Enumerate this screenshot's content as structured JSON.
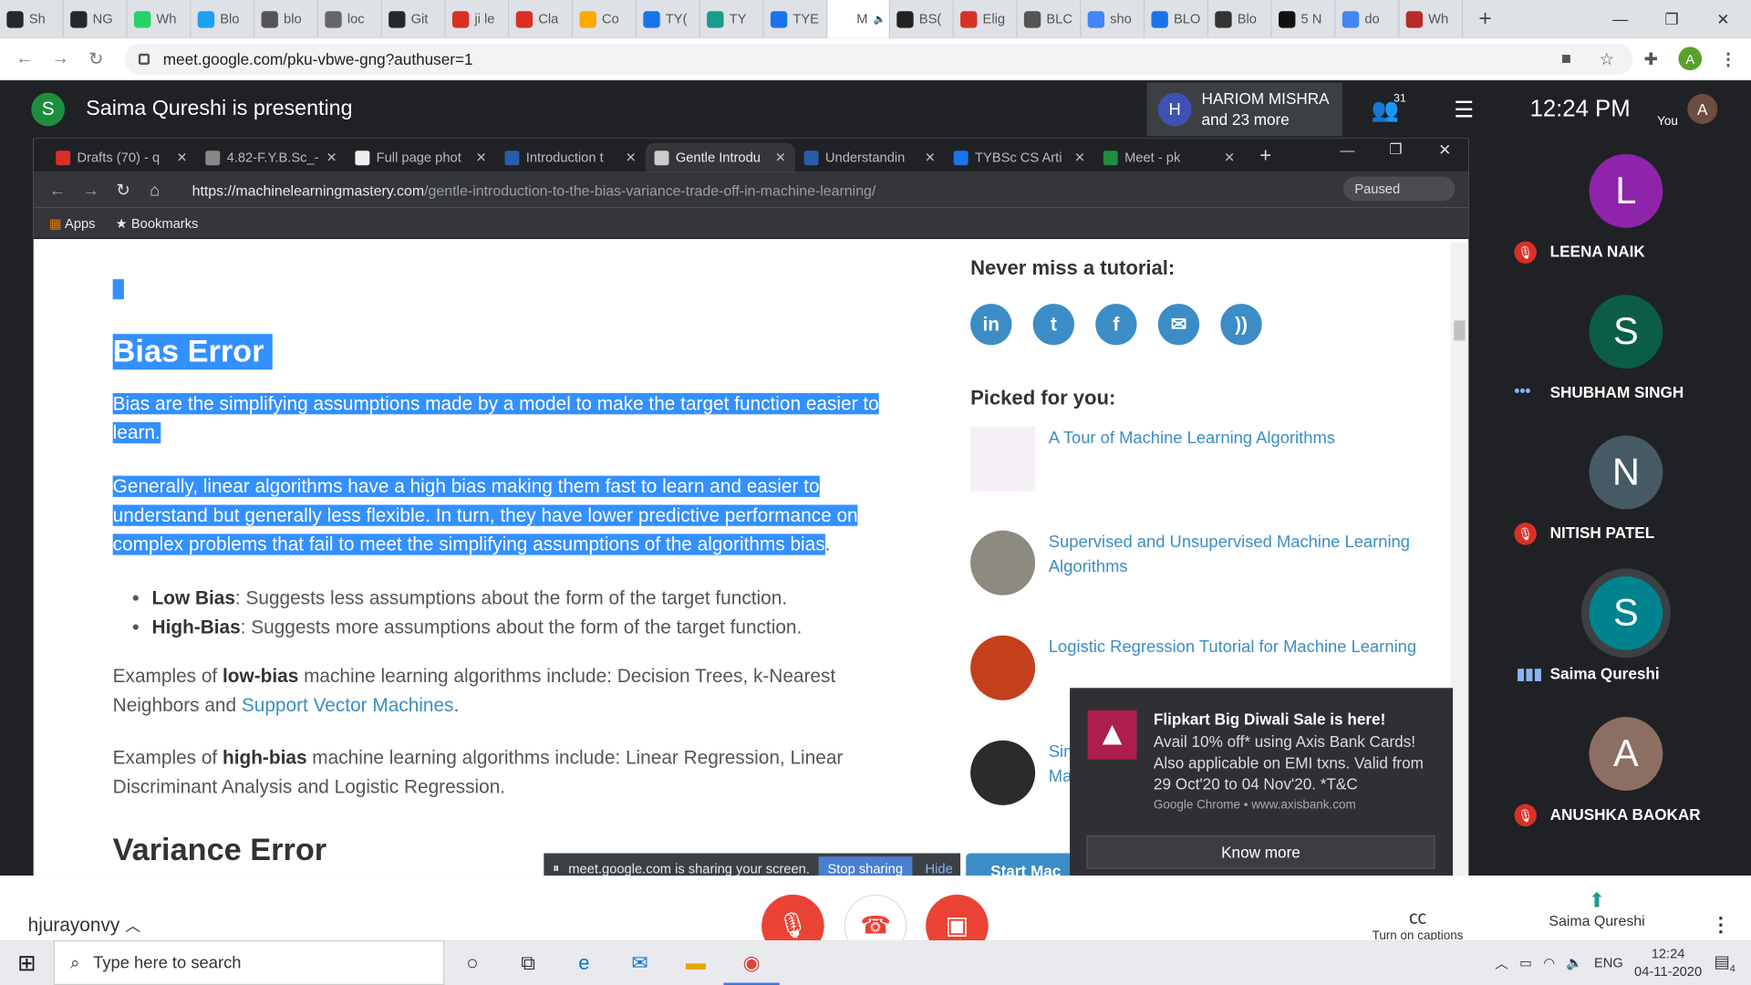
{
  "outer_tabs": [
    {
      "label": "Sh",
      "fav": "#24292e",
      "icon": "github-icon"
    },
    {
      "label": "NG",
      "fav": "#24292e",
      "icon": "github-icon"
    },
    {
      "label": "Wh",
      "fav": "#25d366",
      "icon": "whatsapp-icon"
    },
    {
      "label": "Blo",
      "fav": "#1da1f2",
      "icon": "blog-icon"
    },
    {
      "label": "blo",
      "fav": "#555",
      "icon": "globe-icon"
    },
    {
      "label": "loc",
      "fav": "#666",
      "icon": "doc-icon"
    },
    {
      "label": "Git",
      "fav": "#24292e",
      "icon": "github-icon"
    },
    {
      "label": "ji le",
      "fav": "#d93025",
      "icon": "gmail-icon"
    },
    {
      "label": "Cla",
      "fav": "#d93025",
      "icon": "gmail-icon"
    },
    {
      "label": "Co",
      "fav": "#f9ab00",
      "icon": "classroom-icon"
    },
    {
      "label": "TY(",
      "fav": "#1a73e8",
      "icon": "classroom-icon"
    },
    {
      "label": "TY",
      "fav": "#1a9c8f",
      "icon": "classroom-icon"
    },
    {
      "label": "TYE",
      "fav": "#1a73e8",
      "icon": "classroom-icon"
    },
    {
      "label": "M",
      "fav": "#fff",
      "icon": "audio-icon",
      "active": true
    },
    {
      "label": "BS(",
      "fav": "#222",
      "icon": "it-icon"
    },
    {
      "label": "Elig",
      "fav": "#d93025",
      "icon": "drop-icon"
    },
    {
      "label": "BLC",
      "fav": "#555",
      "icon": "s-icon"
    },
    {
      "label": "sho",
      "fav": "#4285f4",
      "icon": "google-icon"
    },
    {
      "label": "BLO",
      "fav": "#1a73e8",
      "icon": "table-icon"
    },
    {
      "label": "Blo",
      "fav": "#333",
      "icon": "wikipedia-icon"
    },
    {
      "label": "5 N",
      "fav": "#111",
      "icon": "v-icon"
    },
    {
      "label": "do",
      "fav": "#4285f4",
      "icon": "google-icon"
    },
    {
      "label": "Wh",
      "fav": "#b92b27",
      "icon": "quora-icon"
    }
  ],
  "outer_url": "meet.google.com/pku-vbwe-gng?authuser=1",
  "profile_initial": "A",
  "meet": {
    "presenter_initial": "S",
    "presenting_text": "Saima Qureshi is presenting",
    "host_initial": "H",
    "host_name": "HARIOM MISHRA",
    "host_more": "and 23 more",
    "people_count": "31",
    "time": "12:24 PM",
    "you_label": "You",
    "you_initial": "A",
    "meeting_code": "hjurayonvy",
    "captions_label": "Turn on captions",
    "presenter_label": "Saima Qureshi"
  },
  "inner_tabs": [
    {
      "label": "Drafts (70) - q",
      "fav": "#d93025"
    },
    {
      "label": "4.82-F.Y.B.Sc_-",
      "fav": "#888"
    },
    {
      "label": "Full page phot",
      "fav": "#eee"
    },
    {
      "label": "Introduction t",
      "fav": "#2a5caa"
    },
    {
      "label": "Gentle Introdu",
      "fav": "#ccc",
      "active": true
    },
    {
      "label": "Understandin",
      "fav": "#2a5caa"
    },
    {
      "label": "TYBSc CS Arti",
      "fav": "#1a73e8"
    },
    {
      "label": "Meet - pk",
      "fav": "#1e8e3e"
    }
  ],
  "inner_url_host": "https://machinelearningmastery.com",
  "inner_url_path": "/gentle-introduction-to-the-bias-variance-trade-off-in-machine-learning/",
  "paused_label": "Paused",
  "bookmarks": {
    "apps": "Apps",
    "bookmarks": "Bookmarks"
  },
  "article": {
    "heading": "Bias Error",
    "p1": "Bias are the simplifying assumptions made by a model to make the target function easier to learn.",
    "p2": "Generally, linear algorithms have a high bias making them fast to learn and easier to understand but generally less flexible. In turn, they have lower predictive performance on complex problems that fail to meet the simplifying assumptions of the algorithms bias",
    "p2_end": ".",
    "li1_b": "Low Bias",
    "li1": ": Suggests less assumptions about the form of the target function.",
    "li2_b": "High-Bias",
    "li2": ": Suggests more assumptions about the form of the target function.",
    "ex1_a": "Examples of ",
    "ex1_b": "low-bias",
    "ex1_c": " machine learning algorithms include: Decision Trees, k-Nearest Neighbors and ",
    "ex1_link": "Support Vector Machines",
    "ex1_d": ".",
    "ex2_a": "Examples of ",
    "ex2_b": "high-bias",
    "ex2_c": " machine learning algorithms include: Linear Regression, Linear Discriminant Analysis and Logistic Regression.",
    "heading2": "Variance Error"
  },
  "sidebar": {
    "never_miss": "Never miss a tutorial:",
    "picked": "Picked for you:",
    "picks": [
      "A Tour of Machine Learning Algorithms",
      "Supervised and Unsupervised Machine Learning Algorithms",
      "Logistic Regression Tutorial for Machine Learning",
      "Sim\nMa"
    ]
  },
  "share_bar": {
    "text": "meet.google.com is sharing your screen.",
    "stop": "Stop sharing",
    "hide": "Hide"
  },
  "start_btn": "Start Mac",
  "notification": {
    "title": "Flipkart Big Diwali Sale is here!",
    "body": "Avail 10% off* using Axis Bank Cards! Also applicable on EMI txns. Valid from 29 Oct'20 to 04 Nov'20. *T&C",
    "source": "Google Chrome • www.axisbank.com",
    "button": "Know more"
  },
  "participants": [
    {
      "initial": "L",
      "name": "LEENA NAIK",
      "color": "#8e24aa",
      "status": "muted"
    },
    {
      "initial": "S",
      "name": "SHUBHAM SINGH",
      "color": "#0b5e45",
      "status": "dots"
    },
    {
      "initial": "N",
      "name": "NITISH PATEL",
      "color": "#455a64",
      "status": "muted"
    },
    {
      "initial": "S",
      "name": "Saima Qureshi",
      "color": "#00838f",
      "status": "speaking"
    },
    {
      "initial": "A",
      "name": "ANUSHKA BAOKAR",
      "color": "#8d6e63",
      "status": "muted"
    }
  ],
  "taskbar": {
    "search_placeholder": "Type here to search",
    "lang": "ENG",
    "time": "12:24",
    "date": "04-11-2020",
    "notif_count": "4"
  }
}
